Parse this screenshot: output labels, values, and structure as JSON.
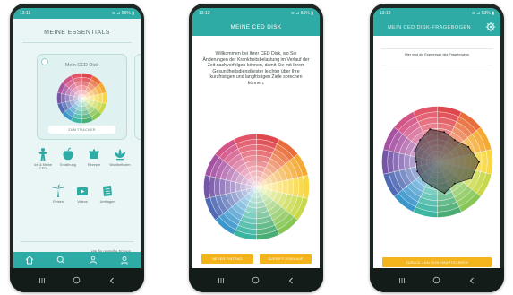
{
  "colors": {
    "teal": "#2eaba5",
    "gold": "#f4b41c",
    "phone_body": "#1d2724",
    "nav_bar": "#141c1a",
    "card_bg": "#dff2f1"
  },
  "wheel_palette": [
    "#dc3b41",
    "#e8642d",
    "#f3a325",
    "#f6d43a",
    "#c5d63d",
    "#7fc24a",
    "#3ea86a",
    "#2fb09c",
    "#2f8fc8",
    "#4561b0",
    "#6b4aa0",
    "#a0479c",
    "#cf4a7f",
    "#e04a5f"
  ],
  "radar_values": [
    0.55,
    0.5,
    0.62,
    0.75,
    0.68,
    0.5,
    0.58,
    0.45,
    0.42,
    0.4,
    0.38,
    0.45,
    0.5,
    0.6
  ],
  "screens": [
    {
      "status_time": "13:11",
      "status_right": "≋ ⊿ 56% ▮",
      "title": "MEINE ESSENTIALS",
      "card": {
        "title": "Mein CED Disk",
        "button": "ZUM TRACKER"
      },
      "tiles": [
        {
          "label": "Ich & Meine CED",
          "icon": "person-figure-icon"
        },
        {
          "label": "Ernährung",
          "icon": "apple-icon"
        },
        {
          "label": "Rezepte",
          "icon": "cooking-pot-icon"
        },
        {
          "label": "Wohlbefinden",
          "icon": "lotus-flower-icon"
        },
        {
          "label": "Reisen",
          "icon": "palm-tree-icon"
        },
        {
          "label": "Videos",
          "icon": "video-icon"
        },
        {
          "label": "Umfragen",
          "icon": "survey-icon"
        }
      ],
      "links": [
        "Datenschutz",
        "Häufig gestellte Fragen"
      ],
      "tabs": [
        "home-icon",
        "search-icon",
        "people-icon",
        "profile-icon"
      ]
    },
    {
      "status_time": "13:12",
      "status_right": "≋ ⊿ 55% ▮",
      "title": "MEINE CED DISK",
      "welcome": "Willkommen bei Ihrer CED Disk, wo Sie Änderungen der Krankheitsbelastung im Verlauf der Zeit nachverfolgen können, damit Sie mit Ihrem Gesundheitsdienstleister leichter über Ihre kurzfristigen und langfristigen Ziele sprechen können.",
      "buttons": [
        "NEUER EINTRAG",
        "ZUGRIFF DISKLAUF"
      ]
    },
    {
      "status_time": "13:13",
      "status_right": "≋ ⊿ 53% ▮",
      "title": "MEIN CED DISK-FRAGEBOGEN",
      "question": "Hier sind die Ergebnisse des Fragebogens",
      "button": "ZURÜCK ZUM DISK-HAUPTSCREEN"
    }
  ]
}
